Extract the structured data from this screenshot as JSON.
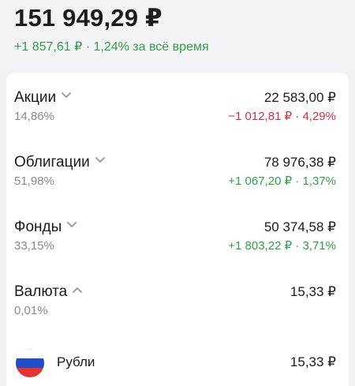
{
  "portfolio": {
    "total": "151 949,29 ₽",
    "change_value": "+1 857,61 ₽ · 1,24%",
    "change_period": "за всё время"
  },
  "categories": [
    {
      "name": "Акции",
      "share": "14,86%",
      "amount": "22 583,00 ₽",
      "delta": "−1 012,81 ₽ · 4,29%",
      "delta_sign": "negative",
      "chevron": "chevron-down-icon"
    },
    {
      "name": "Облигации",
      "share": "51,98%",
      "amount": "78 976,38 ₽",
      "delta": "+1 067,20 ₽ · 1,37%",
      "delta_sign": "positive",
      "chevron": "chevron-down-icon"
    },
    {
      "name": "Фонды",
      "share": "33,15%",
      "amount": "50 374,58 ₽",
      "delta": "+1 803,22 ₽ · 3,71%",
      "delta_sign": "positive",
      "chevron": "chevron-down-icon"
    },
    {
      "name": "Валюта",
      "share": "0,01%",
      "amount": "15,33 ₽",
      "delta": "",
      "delta_sign": "none",
      "chevron": "chevron-up-icon"
    }
  ],
  "currency_items": [
    {
      "name": "Рубли",
      "amount": "15,33 ₽",
      "icon": "russia-flag-icon"
    }
  ],
  "colors": {
    "positive": "#2e9f47",
    "negative": "#d52d3c",
    "secondary_text": "#8a8a8e",
    "background": "#f2f2f4",
    "card": "#ffffff"
  }
}
